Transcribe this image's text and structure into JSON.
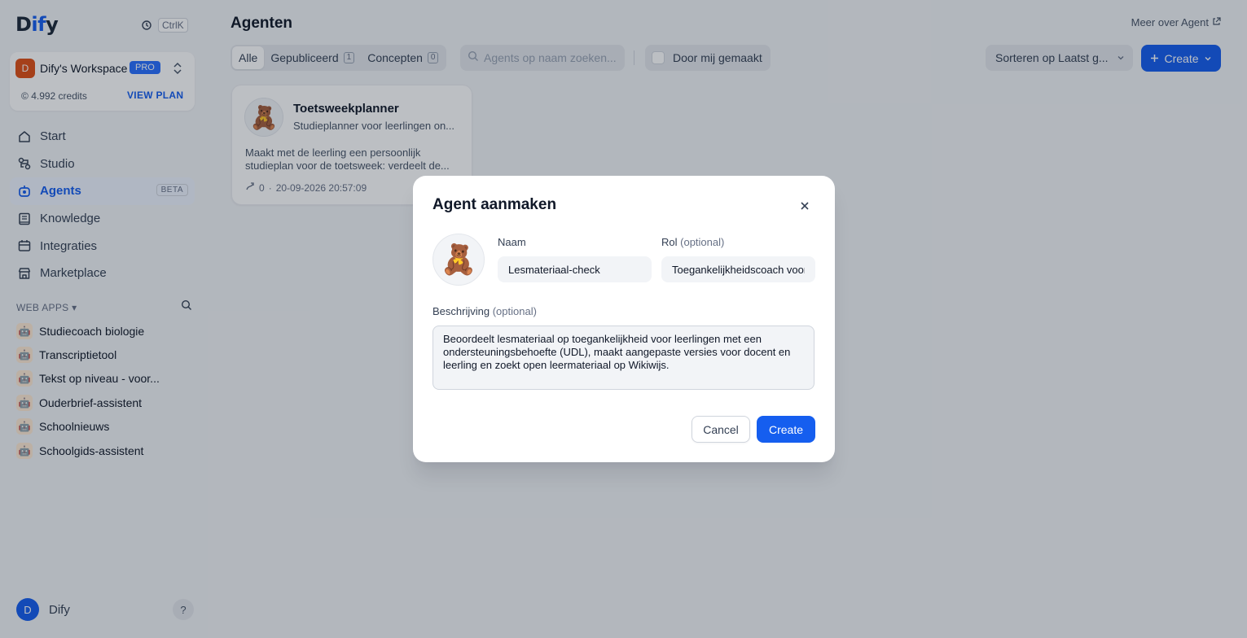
{
  "brand": {
    "logo_prefix": "D",
    "logo_accent": "if",
    "logo_suffix": "y"
  },
  "topbar": {
    "shortcut": "Ctrl",
    "shortcut_key": "K"
  },
  "workspace": {
    "avatar": "D",
    "name": "Dify's Workspace",
    "plan_badge": "PRO",
    "credits": "4.992 credits",
    "credits_icon": "©",
    "view_plan": "VIEW PLAN"
  },
  "nav": [
    {
      "label": "Start",
      "icon": "home-icon"
    },
    {
      "label": "Studio",
      "icon": "studio-icon"
    },
    {
      "label": "Agents",
      "icon": "agent-icon",
      "badge": "BETA",
      "active": true
    },
    {
      "label": "Knowledge",
      "icon": "book-icon"
    },
    {
      "label": "Integraties",
      "icon": "integrations-icon"
    },
    {
      "label": "Marketplace",
      "icon": "store-icon"
    }
  ],
  "web_apps": {
    "label": "WEB APPS",
    "items": [
      "Studiecoach biologie",
      "Transcriptietool",
      "Tekst op niveau - voor...",
      "Ouderbrief-assistent",
      "Schoolnieuws",
      "Schoolgids-assistent"
    ],
    "app_icon_glyph": "🤖"
  },
  "user": {
    "avatar": "D",
    "name": "Dify",
    "help": "?"
  },
  "header": {
    "title": "Agenten",
    "learn_more": "Meer over Agent"
  },
  "filters": {
    "tabs": [
      {
        "label": "Alle",
        "active": true
      },
      {
        "label": "Gepubliceerd",
        "count": "1"
      },
      {
        "label": "Concepten",
        "count": "0"
      }
    ],
    "search_placeholder": "Agents op naam zoeken...",
    "mine_label": "Door mij gemaakt",
    "sort_label": "Sorteren op Laatst g...",
    "create_label": "Create"
  },
  "agents": [
    {
      "avatar": "🧸",
      "name": "Toetsweekplanner",
      "role": "Studieplanner voor leerlingen on...",
      "description": "Maakt met de leerling een persoonlijk studieplan voor de toetsweek: verdeelt de...",
      "runs": "0",
      "updated": "20-09-2026 20:57:09"
    }
  ],
  "modal": {
    "title": "Agent aanmaken",
    "avatar": "🧸",
    "name_label": "Naam",
    "name_value": "Lesmateriaal-check",
    "role_label": "Rol",
    "role_optional": "(optional)",
    "role_value": "Toegankelijkheidscoach voor docenten",
    "desc_label": "Beschrijving",
    "desc_optional": "(optional)",
    "desc_value": "Beoordeelt lesmateriaal op toegankelijkheid voor leerlingen met een ondersteuningsbehoefte (UDL), maakt aangepaste versies voor docent en leerling en zoekt open leermateriaal op Wikiwijs.",
    "cancel": "Cancel",
    "create": "Create"
  }
}
